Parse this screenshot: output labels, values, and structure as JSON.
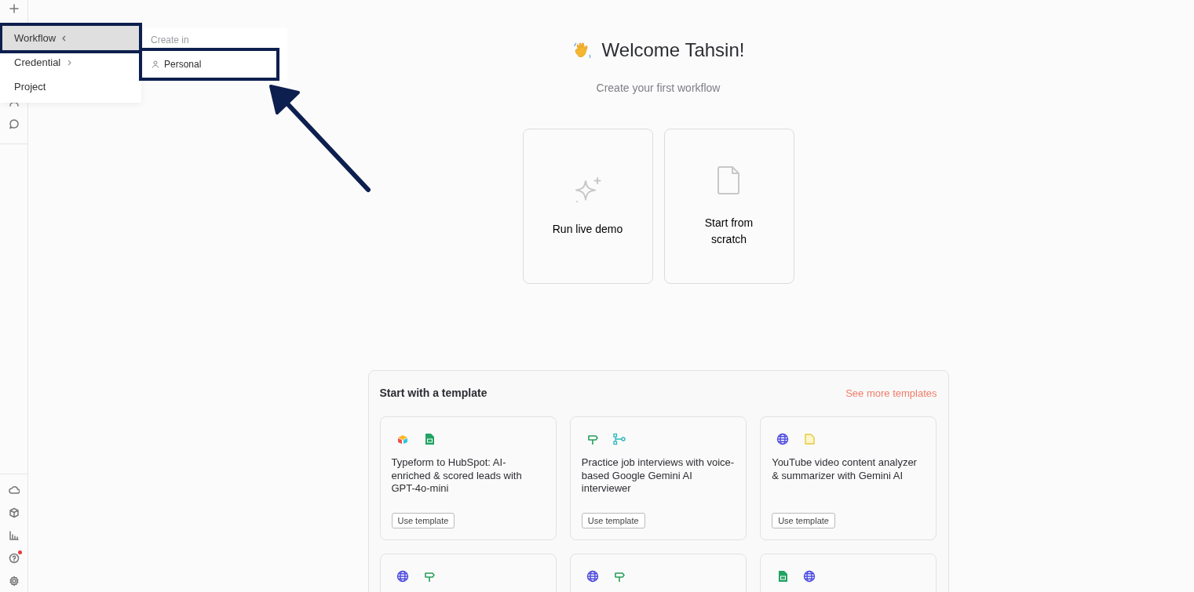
{
  "sidebar": {
    "top_items": [
      {
        "kind": "plus"
      },
      {
        "kind": "user"
      },
      {
        "kind": "chat"
      }
    ],
    "bottom_items": [
      {
        "kind": "cloud",
        "notification": false
      },
      {
        "kind": "box",
        "notification": false
      },
      {
        "kind": "chart",
        "notification": false
      },
      {
        "kind": "help",
        "notification": true
      },
      {
        "kind": "settings",
        "notification": false
      }
    ]
  },
  "create_menu": {
    "items": [
      {
        "label": "Workflow",
        "kind": "open",
        "selected": true,
        "highlighted": true
      },
      {
        "label": "Credential",
        "kind": "closed",
        "selected": false,
        "highlighted": false
      },
      {
        "label": "Project",
        "kind": "plain",
        "selected": false,
        "highlighted": false
      }
    ]
  },
  "submenu": {
    "header": "Create in",
    "items": [
      {
        "label": "Personal",
        "highlighted": true
      }
    ]
  },
  "welcome": {
    "title": "Welcome Tahsin!",
    "subtitle": "Create your first workflow"
  },
  "start_options": [
    {
      "kind": "sparkle",
      "label": "Run live demo"
    },
    {
      "kind": "file",
      "label": "Start from scratch"
    }
  ],
  "templates": {
    "title": "Start with a template",
    "link": "See more templates",
    "cards": [
      {
        "icons": [
          {
            "kind": "airtable"
          },
          {
            "kind": "sheets"
          }
        ],
        "title": "Typeform to HubSpot: AI-enriched & scored leads with GPT-4o-mini",
        "button": "Use template"
      },
      {
        "icons": [
          {
            "kind": "signpost"
          },
          {
            "kind": "flow"
          }
        ],
        "title": "Practice job interviews with voice-based Google Gemini AI interviewer",
        "button": "Use template"
      },
      {
        "icons": [
          {
            "kind": "globe"
          },
          {
            "kind": "note"
          }
        ],
        "title": "YouTube video content analyzer & summarizer with Gemini AI",
        "button": "Use template"
      },
      {
        "icons": [
          {
            "kind": "globe"
          },
          {
            "kind": "signpost"
          }
        ]
      },
      {
        "icons": [
          {
            "kind": "globe"
          },
          {
            "kind": "signpost"
          }
        ]
      },
      {
        "icons": [
          {
            "kind": "sheets"
          },
          {
            "kind": "globe"
          }
        ]
      }
    ]
  }
}
